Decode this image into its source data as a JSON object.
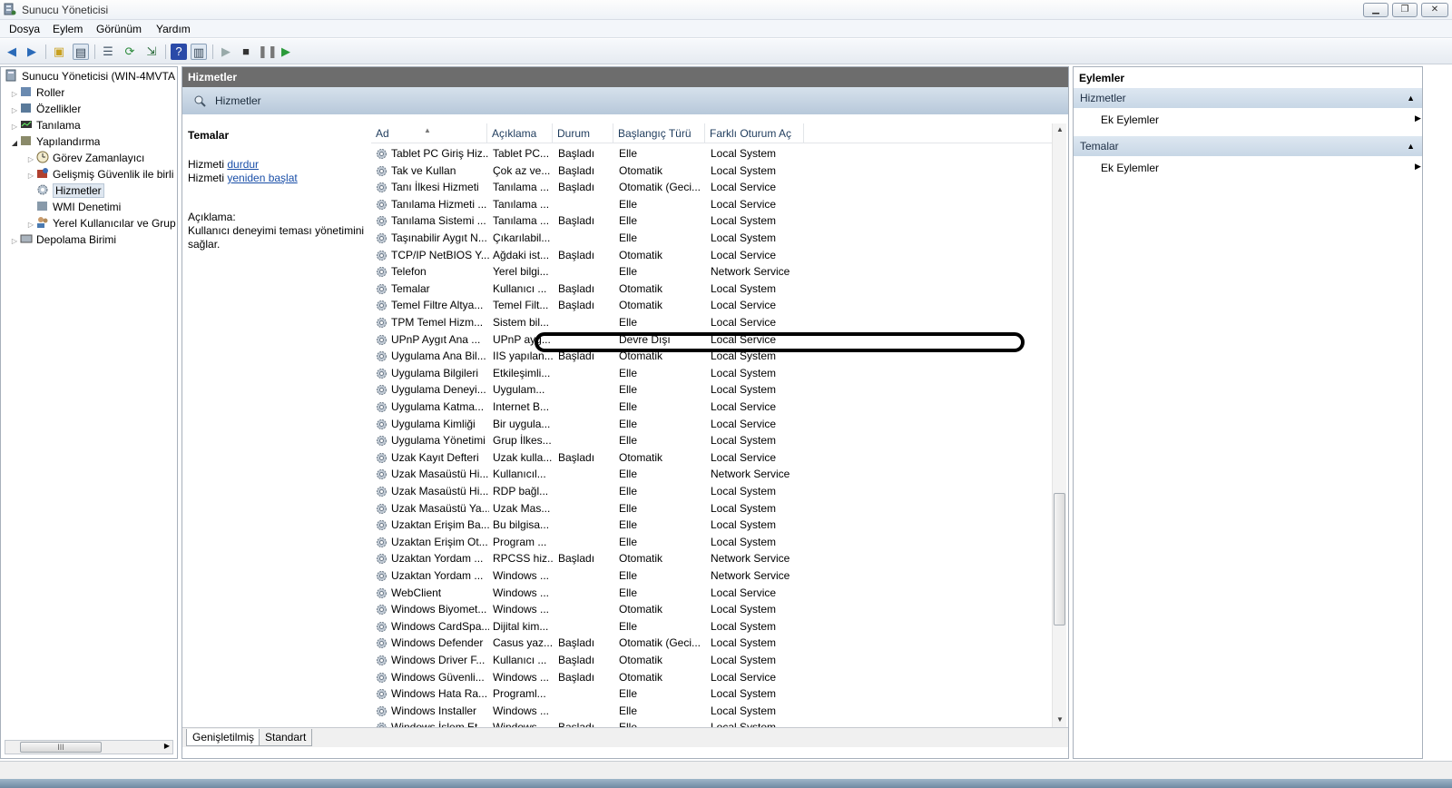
{
  "window": {
    "title": "Sunucu Yöneticisi",
    "min": "▁",
    "max": "❐",
    "close": "✕"
  },
  "menu": [
    "Dosya",
    "Eylem",
    "Görünüm",
    "Yardım"
  ],
  "tree": {
    "root": "Sunucu Yöneticisi (WIN-4MVTA",
    "items": [
      {
        "label": "Roller"
      },
      {
        "label": "Özellikler"
      },
      {
        "label": "Tanılama"
      },
      {
        "label": "Yapılandırma"
      },
      {
        "label": "Görev Zamanlayıcı"
      },
      {
        "label": "Gelişmiş Güvenlik ile birli"
      },
      {
        "label": "Hizmetler"
      },
      {
        "label": "WMI Denetimi"
      },
      {
        "label": "Yerel Kullanıcılar ve Grup"
      },
      {
        "label": "Depolama Birimi"
      }
    ],
    "scroll_label": "III"
  },
  "center": {
    "header": "Hizmetler",
    "band_title": "Hizmetler",
    "desc": {
      "title": "Temalar",
      "line1_prefix": "Hizmeti ",
      "line1_link": "durdur",
      "line2_prefix": "Hizmeti ",
      "line2_link": "yeniden başlat",
      "desc_label": "Açıklama:",
      "desc_text": "Kullanıcı deneyimi teması yönetimini sağlar."
    },
    "columns": [
      "Ad",
      "Açıklama",
      "Durum",
      "Başlangıç Türü",
      "Farklı Oturum Aç"
    ],
    "rows": [
      [
        "Tablet PC Giriş Hiz...",
        "Tablet PC...",
        "Başladı",
        "Elle",
        "Local System"
      ],
      [
        "Tak ve Kullan",
        "Çok az ve...",
        "Başladı",
        "Otomatik",
        "Local System"
      ],
      [
        "Tanı İlkesi Hizmeti",
        "Tanılama ...",
        "Başladı",
        "Otomatik (Geci...",
        "Local Service"
      ],
      [
        "Tanılama Hizmeti ...",
        "Tanılama ...",
        "",
        "Elle",
        "Local Service"
      ],
      [
        "Tanılama Sistemi ...",
        "Tanılama ...",
        "Başladı",
        "Elle",
        "Local System"
      ],
      [
        "Taşınabilir Aygıt N...",
        "Çıkarılabil...",
        "",
        "Elle",
        "Local System"
      ],
      [
        "TCP/IP NetBIOS Y...",
        "Ağdaki ist...",
        "Başladı",
        "Otomatik",
        "Local Service"
      ],
      [
        "Telefon",
        "Yerel bilgi...",
        "",
        "Elle",
        "Network Service"
      ],
      [
        "Temalar",
        "Kullanıcı ...",
        "Başladı",
        "Otomatik",
        "Local System"
      ],
      [
        "Temel Filtre Altya...",
        "Temel Filt...",
        "Başladı",
        "Otomatik",
        "Local Service"
      ],
      [
        "TPM Temel Hizm...",
        "Sistem bil...",
        "",
        "Elle",
        "Local Service"
      ],
      [
        "UPnP Aygıt Ana ...",
        "UPnP ayg...",
        "",
        "Devre Dışı",
        "Local Service"
      ],
      [
        "Uygulama Ana Bil...",
        "IIS yapılan...",
        "Başladı",
        "Otomatik",
        "Local System"
      ],
      [
        "Uygulama Bilgileri",
        "Etkileşimli...",
        "",
        "Elle",
        "Local System"
      ],
      [
        "Uygulama Deneyi...",
        "Uygulam...",
        "",
        "Elle",
        "Local System"
      ],
      [
        "Uygulama Katma...",
        "Internet B...",
        "",
        "Elle",
        "Local Service"
      ],
      [
        "Uygulama Kimliği",
        "Bir uygula...",
        "",
        "Elle",
        "Local Service"
      ],
      [
        "Uygulama Yönetimi",
        "Grup İlkes...",
        "",
        "Elle",
        "Local System"
      ],
      [
        "Uzak Kayıt Defteri",
        "Uzak kulla...",
        "Başladı",
        "Otomatik",
        "Local Service"
      ],
      [
        "Uzak Masaüstü Hi...",
        "Kullanıcıl...",
        "",
        "Elle",
        "Network Service"
      ],
      [
        "Uzak Masaüstü Hi...",
        "RDP bağl...",
        "",
        "Elle",
        "Local System"
      ],
      [
        "Uzak Masaüstü Ya...",
        "Uzak Mas...",
        "",
        "Elle",
        "Local System"
      ],
      [
        "Uzaktan Erişim Ba...",
        "Bu bilgisa...",
        "",
        "Elle",
        "Local System"
      ],
      [
        "Uzaktan Erişim Ot...",
        "Program ...",
        "",
        "Elle",
        "Local System"
      ],
      [
        "Uzaktan Yordam ...",
        "RPCSS hiz...",
        "Başladı",
        "Otomatik",
        "Network Service"
      ],
      [
        "Uzaktan Yordam ...",
        "Windows ...",
        "",
        "Elle",
        "Network Service"
      ],
      [
        "WebClient",
        "Windows ...",
        "",
        "Elle",
        "Local Service"
      ],
      [
        "Windows Biyomet...",
        "Windows ...",
        "",
        "Otomatik",
        "Local System"
      ],
      [
        "Windows CardSpa...",
        "Dijital kim...",
        "",
        "Elle",
        "Local System"
      ],
      [
        "Windows Defender",
        "Casus yaz...",
        "Başladı",
        "Otomatik (Geci...",
        "Local System"
      ],
      [
        "Windows Driver F...",
        "Kullanıcı ...",
        "Başladı",
        "Otomatik",
        "Local System"
      ],
      [
        "Windows Güvenli...",
        "Windows ...",
        "Başladı",
        "Otomatik",
        "Local Service"
      ],
      [
        "Windows Hata Ra...",
        "Programl...",
        "",
        "Elle",
        "Local System"
      ],
      [
        "Windows Installer",
        "Windows ...",
        "",
        "Elle",
        "Local System"
      ],
      [
        "Windows İşlem Et...",
        "Windows ...",
        "Başladı",
        "Elle",
        "Local System"
      ]
    ],
    "tabs": [
      "Genişletilmiş",
      "Standart"
    ]
  },
  "actions": {
    "title": "Eylemler",
    "sections": [
      {
        "title": "Hizmetler",
        "item": "Ek Eylemler"
      },
      {
        "title": "Temalar",
        "item": "Ek Eylemler"
      }
    ]
  }
}
